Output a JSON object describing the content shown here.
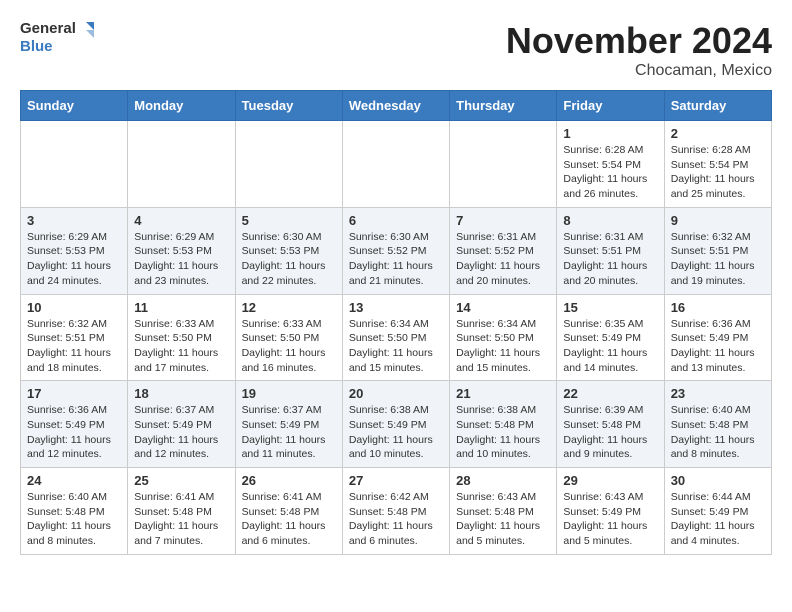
{
  "header": {
    "logo_general": "General",
    "logo_blue": "Blue",
    "month_title": "November 2024",
    "subtitle": "Chocaman, Mexico"
  },
  "days_of_week": [
    "Sunday",
    "Monday",
    "Tuesday",
    "Wednesday",
    "Thursday",
    "Friday",
    "Saturday"
  ],
  "weeks": [
    [
      {
        "day": "",
        "info": ""
      },
      {
        "day": "",
        "info": ""
      },
      {
        "day": "",
        "info": ""
      },
      {
        "day": "",
        "info": ""
      },
      {
        "day": "",
        "info": ""
      },
      {
        "day": "1",
        "info": "Sunrise: 6:28 AM\nSunset: 5:54 PM\nDaylight: 11 hours and 26 minutes."
      },
      {
        "day": "2",
        "info": "Sunrise: 6:28 AM\nSunset: 5:54 PM\nDaylight: 11 hours and 25 minutes."
      }
    ],
    [
      {
        "day": "3",
        "info": "Sunrise: 6:29 AM\nSunset: 5:53 PM\nDaylight: 11 hours and 24 minutes."
      },
      {
        "day": "4",
        "info": "Sunrise: 6:29 AM\nSunset: 5:53 PM\nDaylight: 11 hours and 23 minutes."
      },
      {
        "day": "5",
        "info": "Sunrise: 6:30 AM\nSunset: 5:53 PM\nDaylight: 11 hours and 22 minutes."
      },
      {
        "day": "6",
        "info": "Sunrise: 6:30 AM\nSunset: 5:52 PM\nDaylight: 11 hours and 21 minutes."
      },
      {
        "day": "7",
        "info": "Sunrise: 6:31 AM\nSunset: 5:52 PM\nDaylight: 11 hours and 20 minutes."
      },
      {
        "day": "8",
        "info": "Sunrise: 6:31 AM\nSunset: 5:51 PM\nDaylight: 11 hours and 20 minutes."
      },
      {
        "day": "9",
        "info": "Sunrise: 6:32 AM\nSunset: 5:51 PM\nDaylight: 11 hours and 19 minutes."
      }
    ],
    [
      {
        "day": "10",
        "info": "Sunrise: 6:32 AM\nSunset: 5:51 PM\nDaylight: 11 hours and 18 minutes."
      },
      {
        "day": "11",
        "info": "Sunrise: 6:33 AM\nSunset: 5:50 PM\nDaylight: 11 hours and 17 minutes."
      },
      {
        "day": "12",
        "info": "Sunrise: 6:33 AM\nSunset: 5:50 PM\nDaylight: 11 hours and 16 minutes."
      },
      {
        "day": "13",
        "info": "Sunrise: 6:34 AM\nSunset: 5:50 PM\nDaylight: 11 hours and 15 minutes."
      },
      {
        "day": "14",
        "info": "Sunrise: 6:34 AM\nSunset: 5:50 PM\nDaylight: 11 hours and 15 minutes."
      },
      {
        "day": "15",
        "info": "Sunrise: 6:35 AM\nSunset: 5:49 PM\nDaylight: 11 hours and 14 minutes."
      },
      {
        "day": "16",
        "info": "Sunrise: 6:36 AM\nSunset: 5:49 PM\nDaylight: 11 hours and 13 minutes."
      }
    ],
    [
      {
        "day": "17",
        "info": "Sunrise: 6:36 AM\nSunset: 5:49 PM\nDaylight: 11 hours and 12 minutes."
      },
      {
        "day": "18",
        "info": "Sunrise: 6:37 AM\nSunset: 5:49 PM\nDaylight: 11 hours and 12 minutes."
      },
      {
        "day": "19",
        "info": "Sunrise: 6:37 AM\nSunset: 5:49 PM\nDaylight: 11 hours and 11 minutes."
      },
      {
        "day": "20",
        "info": "Sunrise: 6:38 AM\nSunset: 5:49 PM\nDaylight: 11 hours and 10 minutes."
      },
      {
        "day": "21",
        "info": "Sunrise: 6:38 AM\nSunset: 5:48 PM\nDaylight: 11 hours and 10 minutes."
      },
      {
        "day": "22",
        "info": "Sunrise: 6:39 AM\nSunset: 5:48 PM\nDaylight: 11 hours and 9 minutes."
      },
      {
        "day": "23",
        "info": "Sunrise: 6:40 AM\nSunset: 5:48 PM\nDaylight: 11 hours and 8 minutes."
      }
    ],
    [
      {
        "day": "24",
        "info": "Sunrise: 6:40 AM\nSunset: 5:48 PM\nDaylight: 11 hours and 8 minutes."
      },
      {
        "day": "25",
        "info": "Sunrise: 6:41 AM\nSunset: 5:48 PM\nDaylight: 11 hours and 7 minutes."
      },
      {
        "day": "26",
        "info": "Sunrise: 6:41 AM\nSunset: 5:48 PM\nDaylight: 11 hours and 6 minutes."
      },
      {
        "day": "27",
        "info": "Sunrise: 6:42 AM\nSunset: 5:48 PM\nDaylight: 11 hours and 6 minutes."
      },
      {
        "day": "28",
        "info": "Sunrise: 6:43 AM\nSunset: 5:48 PM\nDaylight: 11 hours and 5 minutes."
      },
      {
        "day": "29",
        "info": "Sunrise: 6:43 AM\nSunset: 5:49 PM\nDaylight: 11 hours and 5 minutes."
      },
      {
        "day": "30",
        "info": "Sunrise: 6:44 AM\nSunset: 5:49 PM\nDaylight: 11 hours and 4 minutes."
      }
    ]
  ]
}
